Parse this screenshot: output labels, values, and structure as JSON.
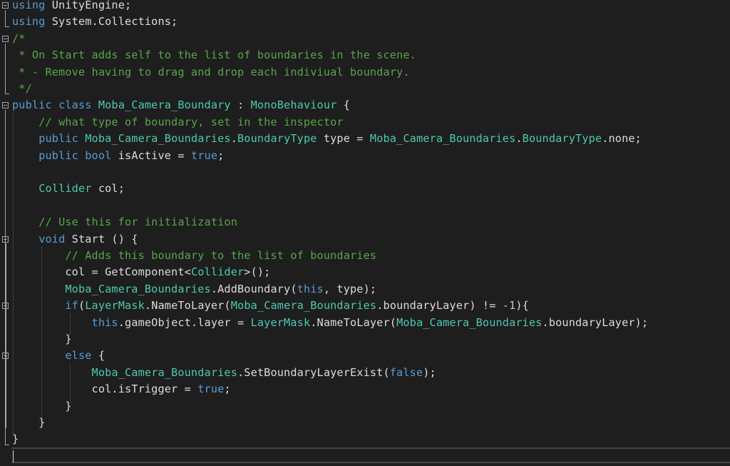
{
  "editor": {
    "lines": [
      {
        "fold": true,
        "tokens": [
          {
            "t": "k",
            "v": "using"
          },
          {
            "t": "p",
            "v": " UnityEngine;"
          }
        ]
      },
      {
        "fold": false,
        "tokens": [
          {
            "t": "k",
            "v": "using"
          },
          {
            "t": "p",
            "v": " System.Collections;"
          }
        ]
      },
      {
        "fold": true,
        "tokens": [
          {
            "t": "c",
            "v": "/*"
          }
        ]
      },
      {
        "fold": false,
        "tokens": [
          {
            "t": "c",
            "v": " * On Start adds self to the list of boundaries in the scene."
          }
        ]
      },
      {
        "fold": false,
        "tokens": [
          {
            "t": "c",
            "v": " * - Remove having to drag and drop each indiviual boundary."
          }
        ]
      },
      {
        "fold": false,
        "tokens": [
          {
            "t": "c",
            "v": " */"
          }
        ]
      },
      {
        "fold": true,
        "tokens": [
          {
            "t": "k",
            "v": "public"
          },
          {
            "t": "p",
            "v": " "
          },
          {
            "t": "k",
            "v": "class"
          },
          {
            "t": "p",
            "v": " "
          },
          {
            "t": "t",
            "v": "Moba_Camera_Boundary"
          },
          {
            "t": "p",
            "v": " : "
          },
          {
            "t": "t",
            "v": "MonoBehaviour"
          },
          {
            "t": "p",
            "v": " {"
          }
        ]
      },
      {
        "fold": false,
        "tokens": [
          {
            "t": "p",
            "v": "    "
          },
          {
            "t": "c",
            "v": "// what type of boundary, set in the inspector"
          }
        ]
      },
      {
        "fold": false,
        "tokens": [
          {
            "t": "p",
            "v": "    "
          },
          {
            "t": "k",
            "v": "public"
          },
          {
            "t": "p",
            "v": " "
          },
          {
            "t": "t",
            "v": "Moba_Camera_Boundaries"
          },
          {
            "t": "p",
            "v": "."
          },
          {
            "t": "t",
            "v": "BoundaryType"
          },
          {
            "t": "p",
            "v": " type = "
          },
          {
            "t": "t",
            "v": "Moba_Camera_Boundaries"
          },
          {
            "t": "p",
            "v": "."
          },
          {
            "t": "t",
            "v": "BoundaryType"
          },
          {
            "t": "p",
            "v": ".none;"
          }
        ]
      },
      {
        "fold": false,
        "tokens": [
          {
            "t": "p",
            "v": "    "
          },
          {
            "t": "k",
            "v": "public"
          },
          {
            "t": "p",
            "v": " "
          },
          {
            "t": "k",
            "v": "bool"
          },
          {
            "t": "p",
            "v": " isActive = "
          },
          {
            "t": "k",
            "v": "true"
          },
          {
            "t": "p",
            "v": ";"
          }
        ]
      },
      {
        "fold": false,
        "tokens": []
      },
      {
        "fold": false,
        "tokens": [
          {
            "t": "p",
            "v": "    "
          },
          {
            "t": "t",
            "v": "Collider"
          },
          {
            "t": "p",
            "v": " col;"
          }
        ]
      },
      {
        "fold": false,
        "tokens": []
      },
      {
        "fold": false,
        "tokens": [
          {
            "t": "p",
            "v": "    "
          },
          {
            "t": "c",
            "v": "// Use this for initialization"
          }
        ]
      },
      {
        "fold": true,
        "tokens": [
          {
            "t": "p",
            "v": "    "
          },
          {
            "t": "k",
            "v": "void"
          },
          {
            "t": "p",
            "v": " Start () {"
          }
        ]
      },
      {
        "fold": false,
        "tokens": [
          {
            "t": "p",
            "v": "        "
          },
          {
            "t": "c",
            "v": "// Adds this boundary to the list of boundaries"
          }
        ]
      },
      {
        "fold": false,
        "tokens": [
          {
            "t": "p",
            "v": "        col = GetComponent<"
          },
          {
            "t": "t",
            "v": "Collider"
          },
          {
            "t": "p",
            "v": ">();"
          }
        ]
      },
      {
        "fold": false,
        "tokens": [
          {
            "t": "p",
            "v": "        "
          },
          {
            "t": "t",
            "v": "Moba_Camera_Boundaries"
          },
          {
            "t": "p",
            "v": ".AddBoundary("
          },
          {
            "t": "k",
            "v": "this"
          },
          {
            "t": "p",
            "v": ", type);"
          }
        ]
      },
      {
        "fold": true,
        "tokens": [
          {
            "t": "p",
            "v": "        "
          },
          {
            "t": "k",
            "v": "if"
          },
          {
            "t": "p",
            "v": "("
          },
          {
            "t": "t",
            "v": "LayerMask"
          },
          {
            "t": "p",
            "v": ".NameToLayer("
          },
          {
            "t": "t",
            "v": "Moba_Camera_Boundaries"
          },
          {
            "t": "p",
            "v": ".boundaryLayer) != "
          },
          {
            "t": "n",
            "v": "-1"
          },
          {
            "t": "p",
            "v": "){"
          }
        ]
      },
      {
        "fold": false,
        "tokens": [
          {
            "t": "p",
            "v": "            "
          },
          {
            "t": "k",
            "v": "this"
          },
          {
            "t": "p",
            "v": ".gameObject.layer = "
          },
          {
            "t": "t",
            "v": "LayerMask"
          },
          {
            "t": "p",
            "v": ".NameToLayer("
          },
          {
            "t": "t",
            "v": "Moba_Camera_Boundaries"
          },
          {
            "t": "p",
            "v": ".boundaryLayer);"
          }
        ]
      },
      {
        "fold": false,
        "tokens": [
          {
            "t": "p",
            "v": "        }"
          }
        ]
      },
      {
        "fold": true,
        "tokens": [
          {
            "t": "p",
            "v": "        "
          },
          {
            "t": "k",
            "v": "else"
          },
          {
            "t": "p",
            "v": " {"
          }
        ]
      },
      {
        "fold": false,
        "tokens": [
          {
            "t": "p",
            "v": "            "
          },
          {
            "t": "t",
            "v": "Moba_Camera_Boundaries"
          },
          {
            "t": "p",
            "v": ".SetBoundaryLayerExist("
          },
          {
            "t": "k",
            "v": "false"
          },
          {
            "t": "p",
            "v": ");"
          }
        ]
      },
      {
        "fold": false,
        "tokens": [
          {
            "t": "p",
            "v": "            col.isTrigger = "
          },
          {
            "t": "k",
            "v": "true"
          },
          {
            "t": "p",
            "v": ";"
          }
        ]
      },
      {
        "fold": false,
        "tokens": [
          {
            "t": "p",
            "v": "        }"
          }
        ]
      },
      {
        "fold": false,
        "tokens": [
          {
            "t": "p",
            "v": "    }"
          }
        ]
      },
      {
        "fold": false,
        "tokens": [
          {
            "t": "p",
            "v": "}"
          }
        ]
      },
      {
        "fold": false,
        "tokens": []
      }
    ]
  },
  "colors": {
    "background": "#1e1e1e",
    "keyword": "#569cd6",
    "type": "#4ec9b0",
    "comment": "#57a64a",
    "text": "#dcdcdc",
    "number": "#b5cea8"
  }
}
